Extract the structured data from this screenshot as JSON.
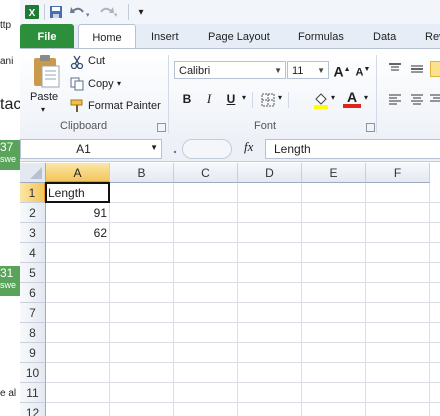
{
  "background_window": {
    "texts": [
      "ttp",
      "ani",
      "tac",
      "37",
      "swe",
      "31",
      "swe",
      "e al"
    ]
  },
  "quick_access": {
    "app_icon": "excel-icon",
    "customize_glyph": "▾"
  },
  "tabs": [
    {
      "label": "File"
    },
    {
      "label": "Home"
    },
    {
      "label": "Insert"
    },
    {
      "label": "Page Layout"
    },
    {
      "label": "Formulas"
    },
    {
      "label": "Data"
    },
    {
      "label": "Rev"
    }
  ],
  "clipboard": {
    "paste_label": "Paste",
    "cut_label": "Cut",
    "copy_label": "Copy",
    "copy_arrow": "▾",
    "format_painter_label": "Format Painter",
    "group_label": "Clipboard"
  },
  "font": {
    "name": "Calibri",
    "size": "11",
    "grow_label": "A",
    "shrink_label": "A",
    "bold": "B",
    "italic": "I",
    "underline": "U",
    "group_label": "Font",
    "colors": {
      "fill": "#ffff00",
      "font": "#e0231a"
    }
  },
  "formula_bar": {
    "cell_ref": "A1",
    "fx_label": "fx",
    "formula": "Length"
  },
  "sheet": {
    "columns": [
      "A",
      "B",
      "C",
      "D",
      "E",
      "F"
    ],
    "rows": [
      "1",
      "2",
      "3",
      "4",
      "5",
      "6",
      "7",
      "8",
      "9",
      "10",
      "11",
      "12"
    ],
    "cells": {
      "A1": "Length",
      "A2": "91",
      "A3": "62"
    },
    "active_cell": "A1"
  },
  "colors": {
    "file_tab": "#2d8f3c",
    "selected_header": "#f3c65b",
    "accent_line": "#e19b24"
  }
}
